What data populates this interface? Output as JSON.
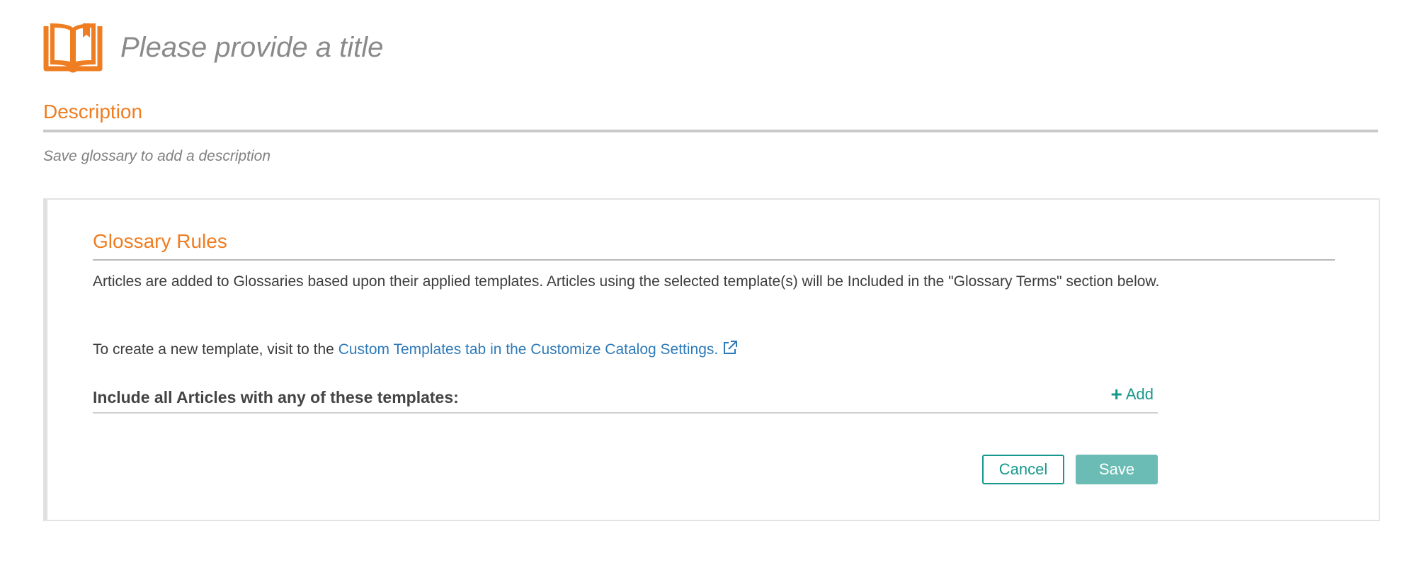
{
  "header": {
    "icon": "book-icon",
    "title_placeholder": "Please provide a title",
    "title_value": ""
  },
  "description": {
    "heading": "Description",
    "text": "Save glossary to add a description"
  },
  "glossary_rules": {
    "heading": "Glossary Rules",
    "paragraph": "Articles are added to Glossaries based upon their applied templates. Articles using the selected template(s) will be Included in the \"Glossary Terms\" section below.",
    "link_prefix": "To create a new template, visit to the ",
    "link_text": "Custom Templates tab in the Customize Catalog Settings.",
    "link_icon": "external-link-icon",
    "templates_label": "Include all Articles with any of these templates:",
    "add_label": "Add",
    "add_icon": "plus-icon"
  },
  "actions": {
    "cancel_label": "Cancel",
    "save_label": "Save"
  },
  "colors": {
    "accent_orange": "#ef7d22",
    "teal": "#17988c",
    "teal_disabled": "#6bbcb4",
    "link_blue": "#2e7ab8"
  }
}
